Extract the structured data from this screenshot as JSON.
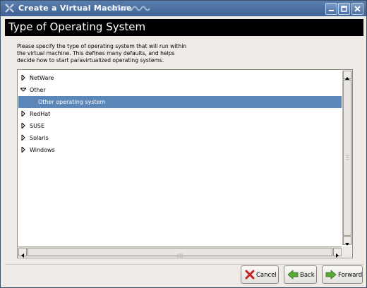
{
  "window": {
    "title": "Create a Virtual Machine",
    "controls": [
      "minimize",
      "maximize",
      "close"
    ]
  },
  "page": {
    "heading": "Type of Operating System",
    "description_lines": [
      "Please specify the type of operating system that will run within",
      "the virtual machine.  This defines many defaults, and helps",
      "decide how to start paravirtualized operating systems."
    ]
  },
  "tree": {
    "items": [
      {
        "label": "NetWare",
        "expanded": false
      },
      {
        "label": "Other",
        "expanded": true
      },
      {
        "label": "Other operating system",
        "child": true,
        "selected": true
      },
      {
        "label": "RedHat",
        "expanded": false
      },
      {
        "label": "SUSE",
        "expanded": false
      },
      {
        "label": "Solaris",
        "expanded": false
      },
      {
        "label": "Windows",
        "expanded": false
      }
    ]
  },
  "buttons": {
    "cancel": "Cancel",
    "back": "Back",
    "forward": "Forward"
  },
  "colors": {
    "titlebar": "#4a6fa5",
    "header_bg": "#000000",
    "selection": "#5b86b8"
  }
}
